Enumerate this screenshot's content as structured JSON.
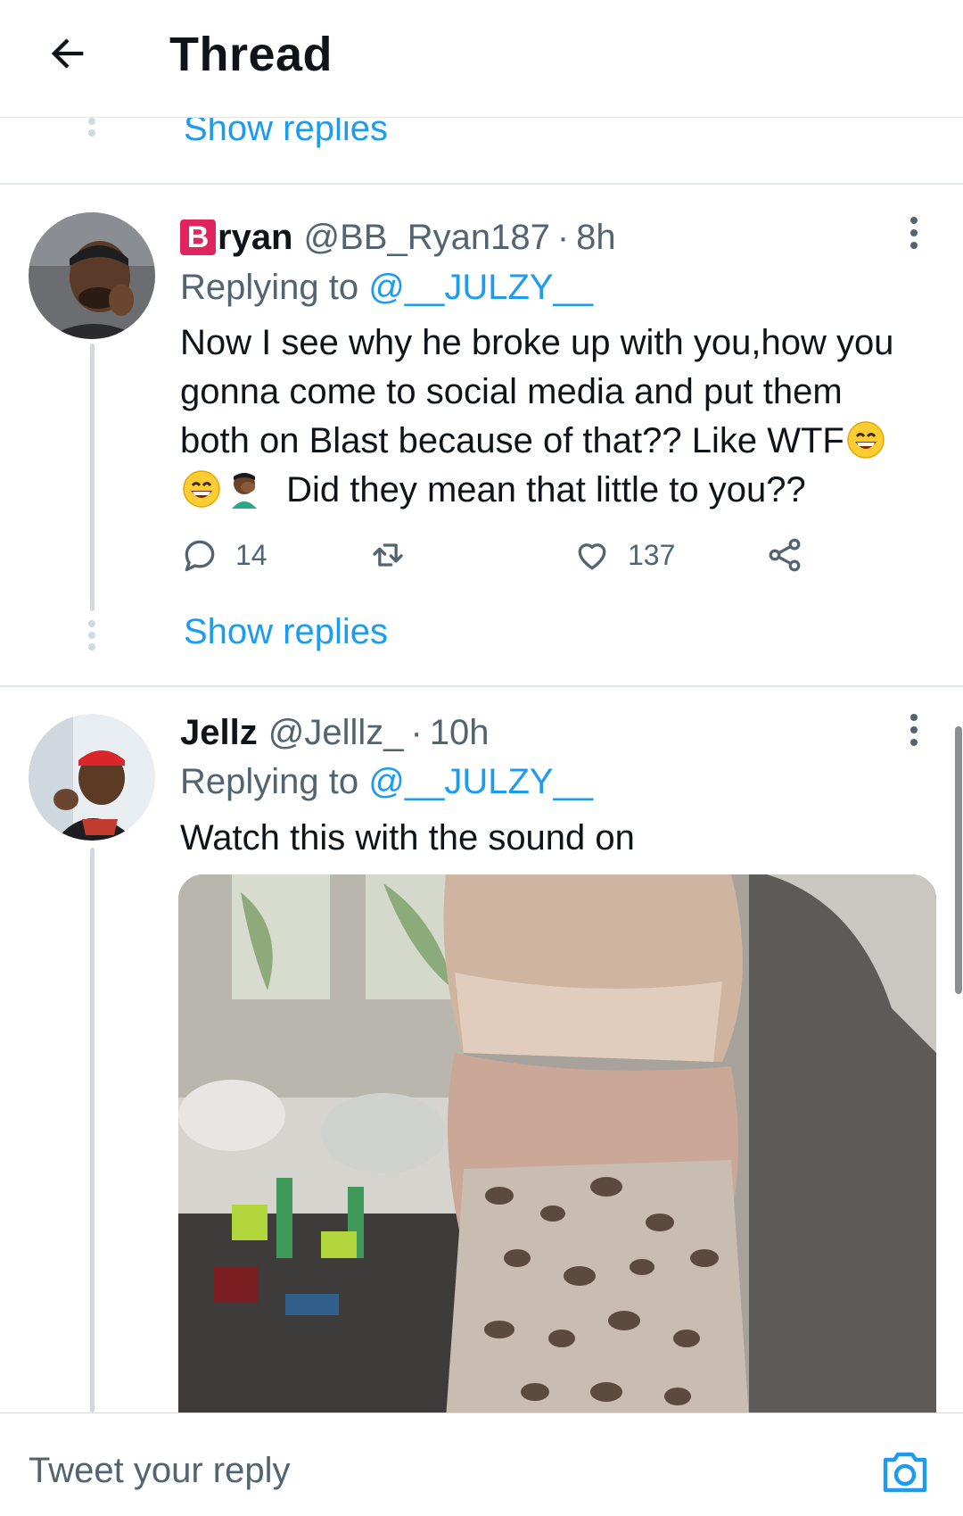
{
  "header": {
    "title": "Thread"
  },
  "top_show_replies": "Show replies",
  "tweets": [
    {
      "badge_letter": "B",
      "name": "ryan",
      "handle": "@BB_Ryan187",
      "separator": "·",
      "time": "8h",
      "replying_prefix": "Replying to",
      "replying_to": "@__JULZY__",
      "text_line1": "Now I see why he broke up with you,how you",
      "text_line2": "gonna come to social media and put them",
      "text_line3": "both on Blast because of that?? Like WTF",
      "text_line4": "Did they mean that little to you??",
      "reply_count": "14",
      "like_count": "137",
      "show_replies": "Show replies"
    },
    {
      "name": "Jellz",
      "handle": "@Jelllz_",
      "separator": "·",
      "time": "10h",
      "replying_prefix": "Replying to",
      "replying_to": "@__JULZY__",
      "text": "Watch this with the sound on"
    }
  ],
  "reply_bar": {
    "placeholder": "Tweet your reply"
  },
  "colors": {
    "link": "#1d9bf0",
    "secondary": "#536471",
    "badge": "#e0245e"
  }
}
